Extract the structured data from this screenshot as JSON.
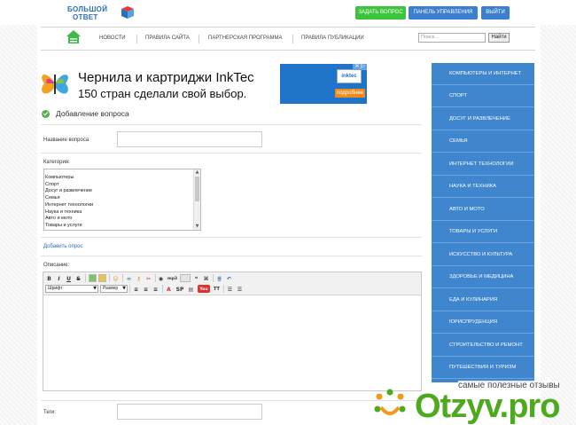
{
  "header": {
    "logo_line1": "БОЛЬШОЙ",
    "logo_line2": "ОТВЕТ",
    "ask_button": "ЗАДАТЬ ВОПРОС",
    "panel_button": "ПАНЕЛЬ УПРАВЛЕНИЯ",
    "exit_button": "ВЫЙТИ",
    "colors": {
      "green": "#3cc43c",
      "blue": "#3a7fd0"
    }
  },
  "nav": {
    "items": [
      "НОВОСТИ",
      "ПРАВИЛА САЙТА",
      "ПАРТНЕРСКАЯ ПРОГРАММА",
      "ПРАВИЛА ПУБЛИКАЦИИ"
    ],
    "search_placeholder": "Поиск...",
    "search_button": "Найти"
  },
  "ad": {
    "title": "Чернила и картриджи InkTec",
    "subtitle": "150 стран сделали свой выбор.",
    "logo": "inktec",
    "more_button": "подробнее",
    "close": "✕ ▷"
  },
  "form": {
    "page_title": "Добавление вопроса",
    "question_label": "Название вопроса",
    "category_label": "Категория:",
    "categories": [
      "Компьютеры",
      "Спорт",
      "Досуг и развлечение",
      "Семья",
      "Интернет технологии",
      "Наука и техника",
      "Авто и мото",
      "Товары и услуги"
    ],
    "add_poll_link": "Добавить опрос",
    "description_label": "Описание:",
    "tags_label": "Теги:"
  },
  "editor": {
    "font_select": "Шрифт",
    "size_select": "Размер",
    "mp3_label": "mp3",
    "sp_label": "SP",
    "tt_label": "TT",
    "youtube_label": "You"
  },
  "sidebar": {
    "color": "#3f86cf",
    "items": [
      "КОМПЬЮТЕРЫ И ИНТЕРНЕТ",
      "СПОРТ",
      "ДОСУГ И РАЗВЛЕЧЕНИЕ",
      "СЕМЬЯ",
      "ИНТЕРНЕТ ТЕХНОЛОГИИ",
      "НАУКА И ТЕХНИКА",
      "АВТО И МОТО",
      "ТОВАРЫ И УСЛУГИ",
      "ИСКУССТВО И КУЛЬТУРА",
      "ЗДОРОВЬЕ И МЕДИЦИНА",
      "ЕДА И КУЛИНАРИЯ",
      "ЮРИСПРУДЕНЦИЯ",
      "СТРОИТЕЛЬСТВО И РЕМОНТ",
      "ПУТЕШЕСТВИЯ И ТУРИЗМ"
    ]
  },
  "watermark": {
    "tagline": "самые полезные отзывы",
    "word": "Otzyv.pro"
  }
}
